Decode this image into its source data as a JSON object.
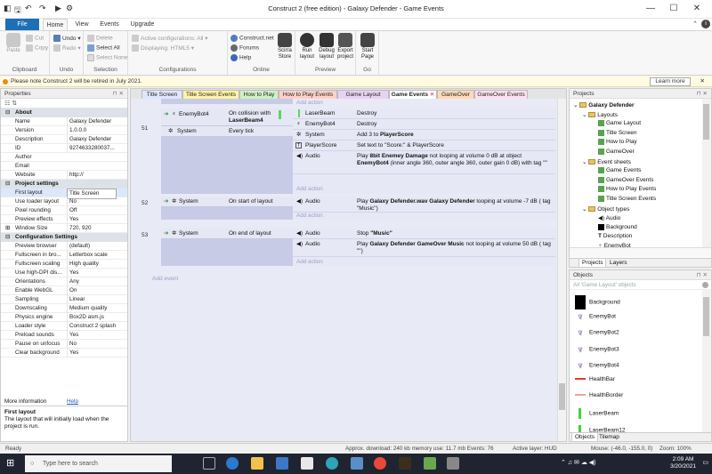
{
  "window": {
    "title": "Construct 2  (free edition) - Galaxy Defender - Game Events",
    "min": "—",
    "max": "☐",
    "close": "✕"
  },
  "qat": {
    "save": "🖫",
    "undo": "↶",
    "redo": "↷",
    "play": "▶",
    "debug": "⚙"
  },
  "ribbon_tabs": [
    "File",
    "Home",
    "View",
    "Events",
    "Upgrade"
  ],
  "ribbon": {
    "clipboard": {
      "label": "Clipboard",
      "paste": "Paste",
      "cut": "Cut",
      "copy": "Copy"
    },
    "undo": {
      "label": "Undo",
      "undo": "Undo",
      "redo": "Redo"
    },
    "selection": {
      "label": "Selection",
      "delete": "Delete",
      "select_all": "Select All",
      "select_none": "Select None"
    },
    "configurations": {
      "label": "Configurations",
      "active": "Active configurations: All",
      "displaying": "Displaying: HTML5"
    },
    "online": {
      "label": "Online",
      "construct": "Construct.net",
      "forums": "Forums",
      "help": "Help",
      "scirra_store": "Scirra Store"
    },
    "preview": {
      "label": "Preview",
      "run": "Run layout",
      "debug": "Debug layout",
      "export": "Export project"
    },
    "go": {
      "label": "Go",
      "start": "Start Page"
    }
  },
  "notification": {
    "text": "Please note Construct 2 will be retired in July 2021.",
    "button": "Learn more",
    "close": "✕"
  },
  "properties": {
    "header": "Properties",
    "categories": [
      {
        "name": "About",
        "rows": [
          [
            "Name",
            "Galaxy Defender"
          ],
          [
            "Version",
            "1.0.0.0"
          ],
          [
            "Description",
            "Galaxy Defender"
          ],
          [
            "ID",
            "9274633280037..."
          ],
          [
            "Author",
            ""
          ],
          [
            "Email",
            ""
          ],
          [
            "Website",
            "http://"
          ]
        ]
      },
      {
        "name": "Project settings",
        "rows": [
          [
            "First layout",
            "Title Screen"
          ],
          [
            "Use loader layout",
            "No"
          ],
          [
            "Pixel rounding",
            "Off"
          ],
          [
            "Preview effects",
            "Yes"
          ],
          [
            "Window Size",
            "720, 920"
          ]
        ]
      },
      {
        "name": "Configuration Settings",
        "rows": [
          [
            "Preview browser",
            "(default)"
          ],
          [
            "Fullscreen in bro...",
            "Letterbox scale"
          ],
          [
            "Fullscreen scaling",
            "High quality"
          ],
          [
            "Use high-DPI dis...",
            "Yes"
          ],
          [
            "Orientations",
            "Any"
          ],
          [
            "Enable WebGL",
            "On"
          ],
          [
            "Sampling",
            "Linear"
          ],
          [
            "Downscaling",
            "Medium quality"
          ],
          [
            "Physics engine",
            "Box2D asm.js"
          ],
          [
            "Loader style",
            "Construct 2 splash"
          ],
          [
            "Preload sounds",
            "Yes"
          ],
          [
            "Pause on unfocus",
            "No"
          ],
          [
            "Clear background",
            "Yes"
          ]
        ]
      }
    ],
    "more_info": "More information",
    "help_link": "Help",
    "info_title": "First layout",
    "info_text": "The layout that will initially load when the project is run."
  },
  "doc_tabs": [
    {
      "label": "Title Screen",
      "color": "#dfe6ff"
    },
    {
      "label": "Title Screen Events",
      "color": "#fff4a3"
    },
    {
      "label": "How to Play",
      "color": "#ccf2c4"
    },
    {
      "label": "How to Play Events",
      "color": "#ffd0c8"
    },
    {
      "label": "Game Layout",
      "color": "#e8d2f4"
    },
    {
      "label": "Game Events",
      "color": "#d8f4d0"
    },
    {
      "label": "GameOver",
      "color": "#ffd9b8"
    },
    {
      "label": "GameOver Events",
      "color": "#ffe0ee"
    }
  ],
  "events": {
    "add_action": "Add action",
    "add_event": "Add event",
    "e51": {
      "num": "51",
      "cond1_obj": "EnemyBot4",
      "cond1_text": "On collision with",
      "cond1_bold": "LaserBeam4",
      "cond2_obj": "System",
      "cond2_text": "Every tick",
      "actions": [
        {
          "obj": "LaserBeam",
          "text": "Destroy"
        },
        {
          "obj": "EnemyBot4",
          "text": "Destroy"
        },
        {
          "obj": "System",
          "pre": "Add 3 to ",
          "bold": "PlayerScore"
        },
        {
          "obj": "PlayerScore",
          "text": "Set text to \"Score:\" & PlayerScore"
        },
        {
          "obj": "Audio",
          "pre": "Play ",
          "bold": "8bit Enemey Damage",
          "mid": " not looping at volume 0 dB at object ",
          "bold2": "EnemyBot4",
          "post": " (inner angle 360, outer angle 360, outer gain 0 dB) with tag \"\""
        }
      ]
    },
    "e52": {
      "num": "52",
      "obj": "System",
      "cond": "On start of layout",
      "act_obj": "Audio",
      "pre": "Play ",
      "bold": "Galaxy Defender.wav Galaxy Defender",
      "post": " looping at volume -7 dB ( tag \"Music\")"
    },
    "e53": {
      "num": "53",
      "obj": "System",
      "cond": "On end of layout",
      "a1_obj": "Audio",
      "a1_pre": "Stop ",
      "a1_bold": "\"Music\"",
      "a2_obj": "Audio",
      "a2_pre": "Play ",
      "a2_bold": "Galaxy Defender GameOver Music",
      "a2_post": " not looping at volume 50 dB ( tag \"\")"
    }
  },
  "projects": {
    "header": "Projects",
    "tree": [
      {
        "label": "Galaxy Defender",
        "lvl": 0,
        "kind": "root"
      },
      {
        "label": "Layouts",
        "lvl": 1,
        "kind": "folder"
      },
      {
        "label": "Game Layout",
        "lvl": 2,
        "kind": "item"
      },
      {
        "label": "Title Screen",
        "lvl": 2,
        "kind": "item"
      },
      {
        "label": "How to Play",
        "lvl": 2,
        "kind": "item"
      },
      {
        "label": "GameOver",
        "lvl": 2,
        "kind": "item"
      },
      {
        "label": "Event sheets",
        "lvl": 1,
        "kind": "folder"
      },
      {
        "label": "Game Events",
        "lvl": 2,
        "kind": "item"
      },
      {
        "label": "GameOver Events",
        "lvl": 2,
        "kind": "item"
      },
      {
        "label": "How to Play Events",
        "lvl": 2,
        "kind": "item"
      },
      {
        "label": "Title Screen Events",
        "lvl": 2,
        "kind": "item"
      },
      {
        "label": "Object types",
        "lvl": 1,
        "kind": "folder"
      },
      {
        "label": "Audio",
        "lvl": 2,
        "kind": "audio"
      },
      {
        "label": "Background",
        "lvl": 2,
        "kind": "bg"
      },
      {
        "label": "Description",
        "lvl": 2,
        "kind": "text"
      },
      {
        "label": "EnemyBot",
        "lvl": 2,
        "kind": "bot"
      }
    ],
    "tabs": [
      "Projects",
      "Layers"
    ]
  },
  "objects": {
    "header": "Objects",
    "filter": "All 'Game Layout' objects",
    "items": [
      {
        "label": "Background",
        "kind": "black"
      },
      {
        "label": "EnemyBot",
        "kind": "bot"
      },
      {
        "label": "EnemyBot2",
        "kind": "bot"
      },
      {
        "label": "EnemyBot3",
        "kind": "bot"
      },
      {
        "label": "EnemyBot4",
        "kind": "bot"
      },
      {
        "label": "HealthBar",
        "kind": "red"
      },
      {
        "label": "HealthBorder",
        "kind": "pink"
      },
      {
        "label": "LaserBeam",
        "kind": "green"
      },
      {
        "label": "LaserBeam12",
        "kind": "green"
      }
    ],
    "tabs": [
      "Objects",
      "Tilemap"
    ]
  },
  "status": {
    "ready": "Ready",
    "download": "Approx. download: 240 kb  memory use: 11.7 mb  Events: 76",
    "layer": "Active layer: HUD",
    "mouse": "Mouse: (-46.0, -155.0, 0)",
    "zoom": "Zoom: 100%"
  },
  "taskbar": {
    "search": "Type here to search",
    "time": "2:09 AM",
    "date": "3/20/2021"
  },
  "colors": {
    "accent": "#1d6fb8",
    "event_bg": "#e8eaf6",
    "condition_bg": "#c8cbe6"
  }
}
